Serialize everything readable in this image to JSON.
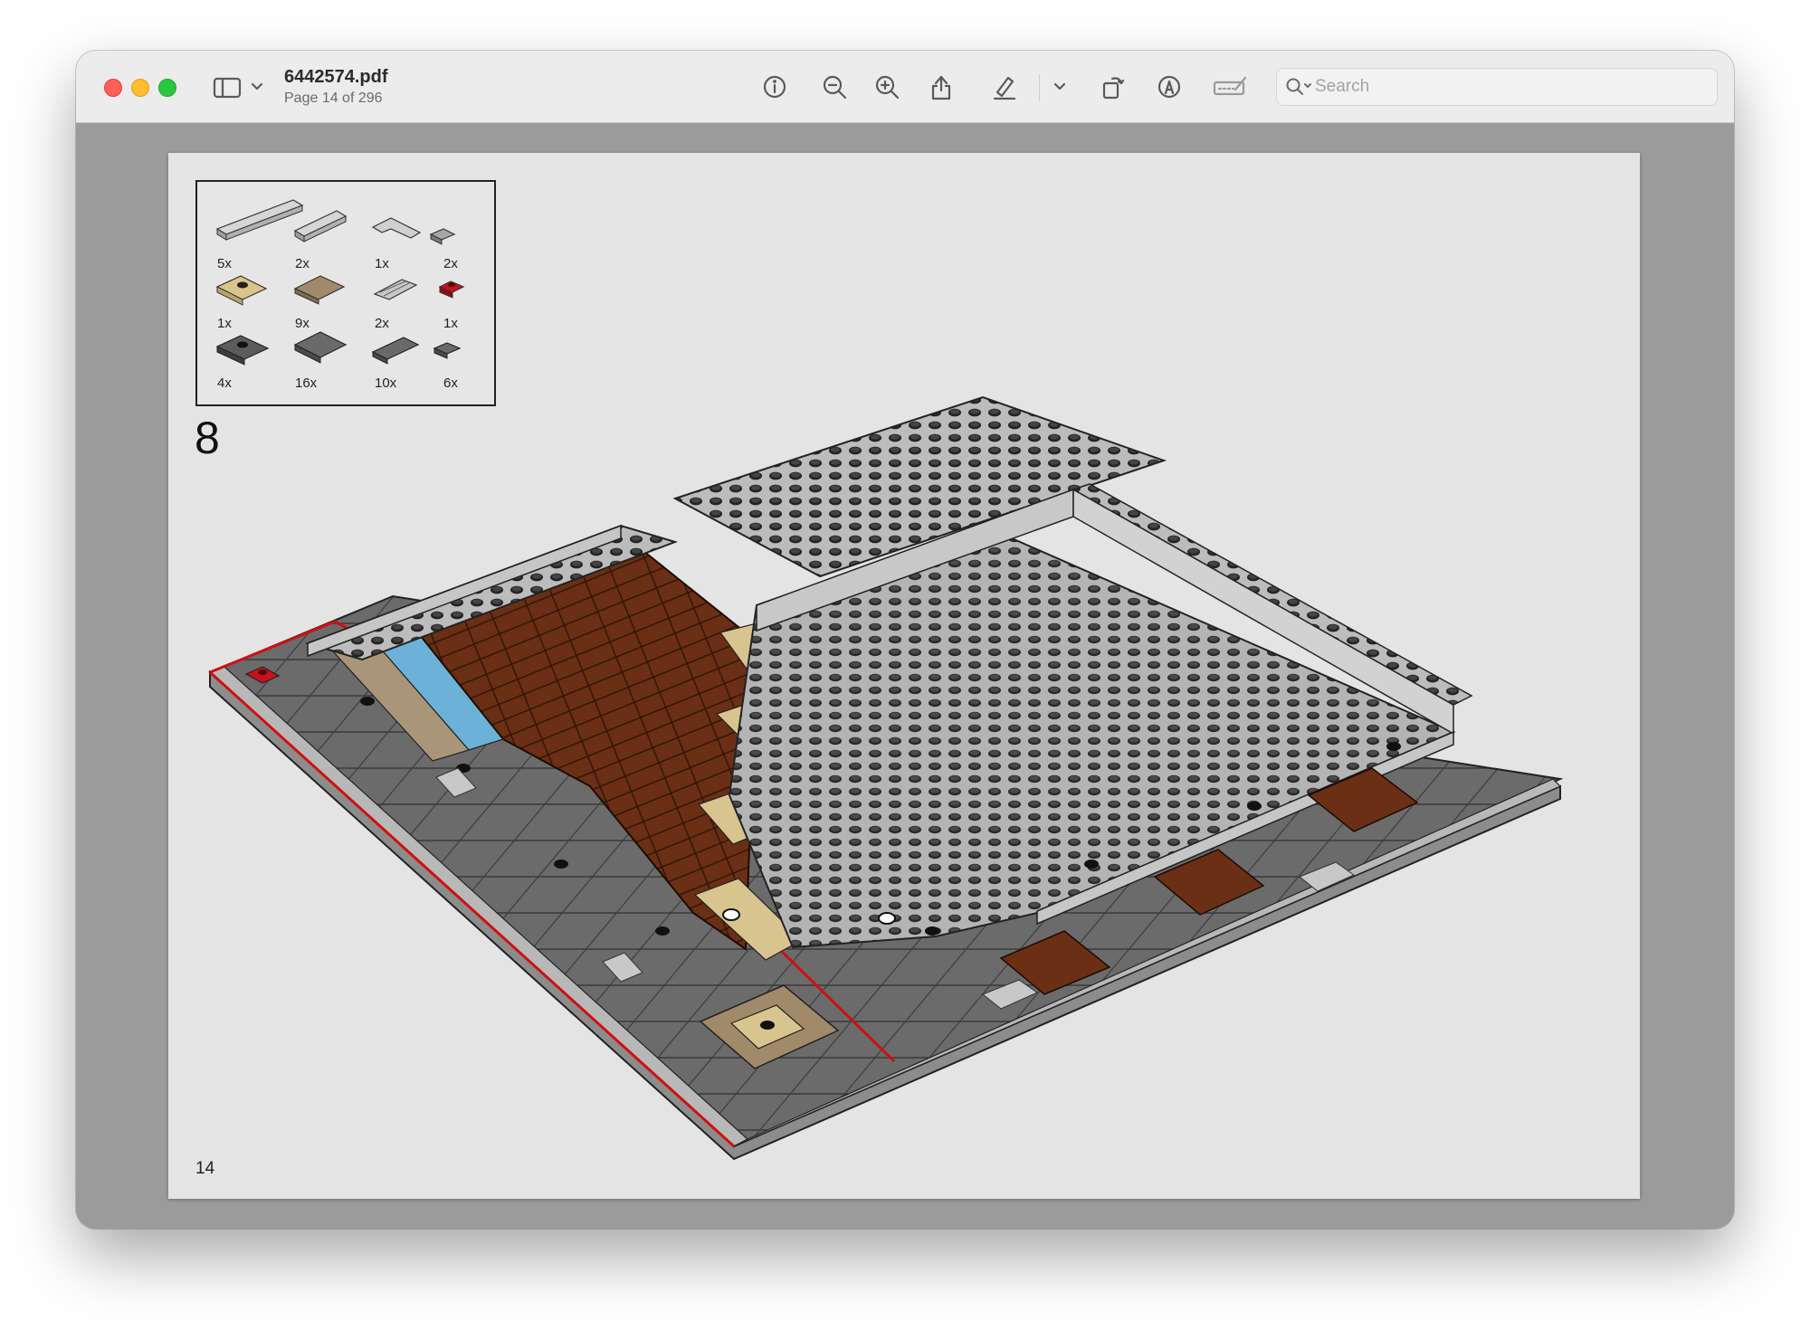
{
  "window": {
    "document_title": "6442574.pdf",
    "page_indicator": "Page 14 of 296"
  },
  "toolbar": {
    "sidebar_icon": "sidebar-icon",
    "info_icon": "info-icon",
    "zoom_out_icon": "zoom-out-icon",
    "zoom_in_icon": "zoom-in-icon",
    "share_icon": "share-icon",
    "markup_icon": "highlighter-icon",
    "rotate_icon": "rotate-icon",
    "annotate_icon": "markup-pen-icon",
    "signature_icon": "signature-icon",
    "search_placeholder": "Search"
  },
  "instruction_page": {
    "step_number": "8",
    "page_number": "14",
    "parts": [
      {
        "qty": "5x",
        "color": "#b8b8b8"
      },
      {
        "qty": "2x",
        "color": "#b8b8b8"
      },
      {
        "qty": "1x",
        "color": "#b8b8b8"
      },
      {
        "qty": "2x",
        "color": "#8a8a8a"
      },
      {
        "qty": "1x",
        "color": "#d9c48a"
      },
      {
        "qty": "9x",
        "color": "#a08a6a"
      },
      {
        "qty": "2x",
        "color": "#b0b0b0"
      },
      {
        "qty": "1x",
        "color": "#c8121b"
      },
      {
        "qty": "4x",
        "color": "#5c5c5c"
      },
      {
        "qty": "16x",
        "color": "#6a6a6a"
      },
      {
        "qty": "10x",
        "color": "#6a6a6a"
      },
      {
        "qty": "6x",
        "color": "#6a6a6a"
      }
    ]
  }
}
